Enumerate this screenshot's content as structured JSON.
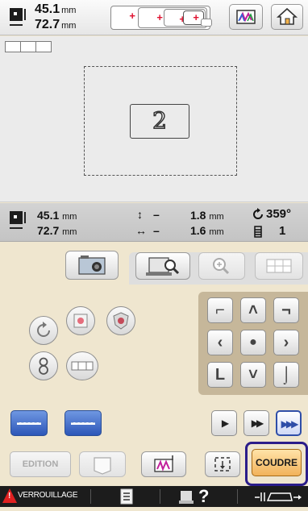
{
  "top": {
    "width_value": "45.1",
    "height_value": "72.7",
    "unit": "mm"
  },
  "info": {
    "width_value": "45.1",
    "height_value": "72.7",
    "unit": "mm",
    "move_v_sign": "–",
    "move_v_value": "1.8",
    "move_h_sign": "–",
    "move_h_value": "1.6",
    "rotation": "359°",
    "color_count": "1"
  },
  "preview": {
    "pattern_text": "2"
  },
  "buttons": {
    "edit_label": "EDITION",
    "sew_label": "COUDRE"
  },
  "bottom": {
    "lock_label": "VERROUILLAGE",
    "help_label": "?"
  },
  "icons": [
    "home-icon",
    "color-palette-icon",
    "camera-icon",
    "scan-magnify-icon",
    "zoom-icon",
    "grid-icon",
    "rotate-icon",
    "mirror-icon",
    "density-icon",
    "thread-order-icon",
    "array-icon",
    "arrow-icon",
    "play-icon",
    "fast-forward-icon"
  ],
  "colors": {
    "accent_blue": "#2c56b8",
    "sew_orange": "#f2b25a",
    "selection_outline": "#2b1d8a",
    "warning_red": "#e02020"
  }
}
